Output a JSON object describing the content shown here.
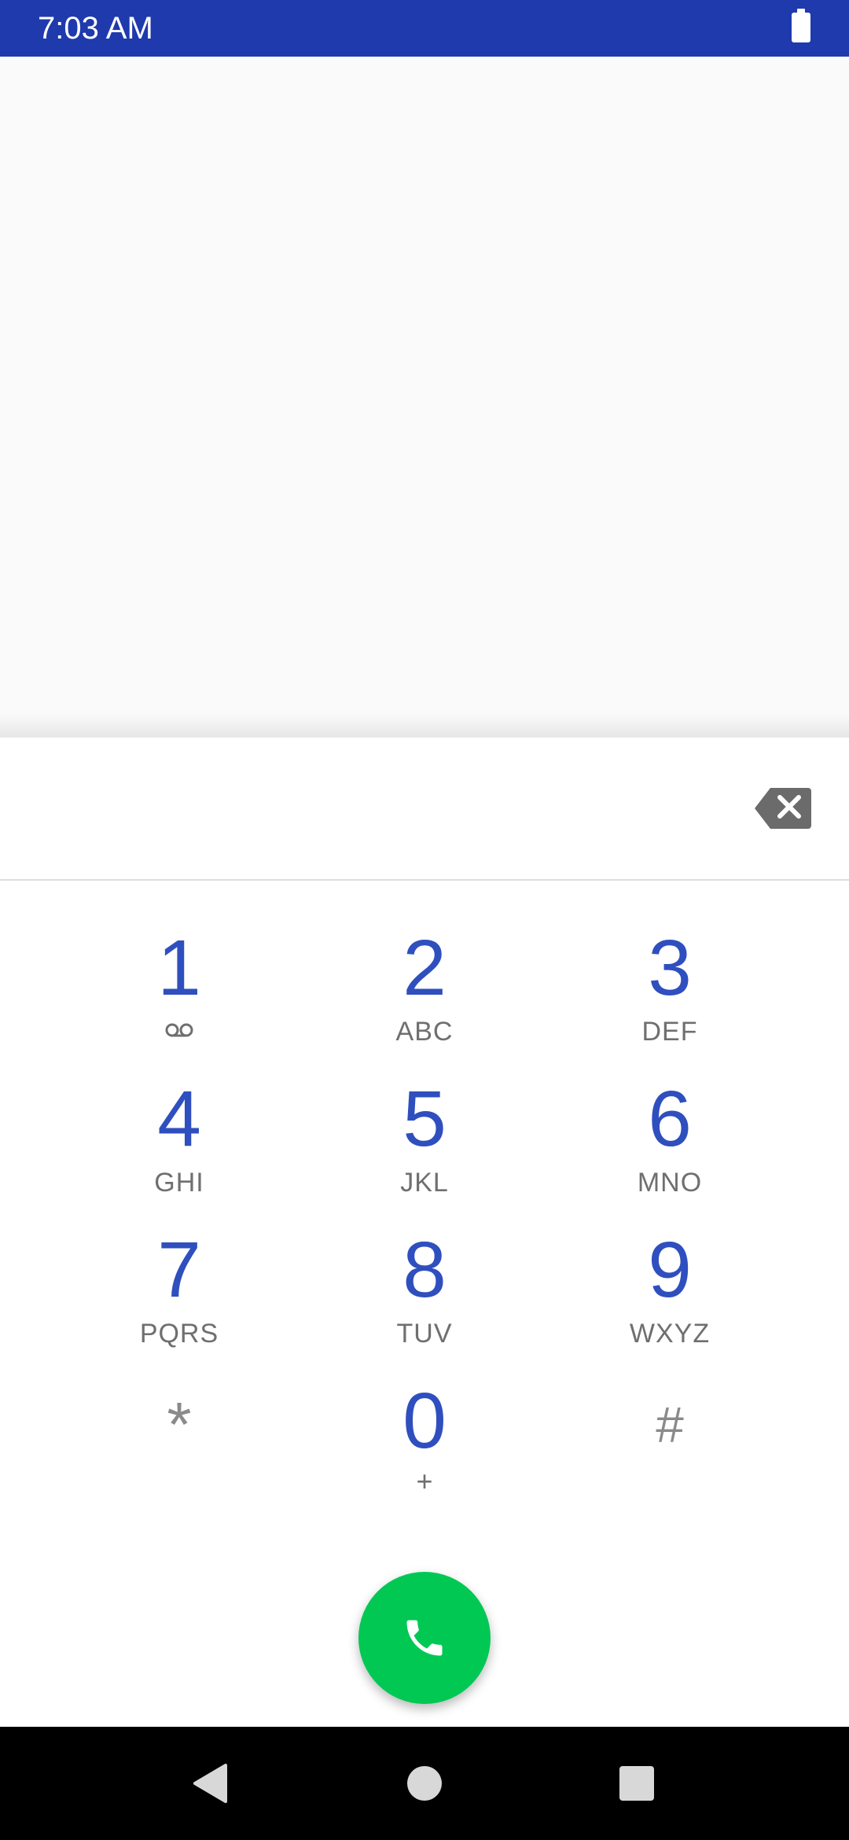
{
  "status_bar": {
    "time": "7:03 AM",
    "battery_icon": "battery-full-icon"
  },
  "dialer": {
    "digits_value": "",
    "backspace_icon": "backspace-icon"
  },
  "keys": [
    {
      "digit": "1",
      "letters": "",
      "icon": "voicemail-icon"
    },
    {
      "digit": "2",
      "letters": "ABC"
    },
    {
      "digit": "3",
      "letters": "DEF"
    },
    {
      "digit": "4",
      "letters": "GHI"
    },
    {
      "digit": "5",
      "letters": "JKL"
    },
    {
      "digit": "6",
      "letters": "MNO"
    },
    {
      "digit": "7",
      "letters": "PQRS"
    },
    {
      "digit": "8",
      "letters": "TUV"
    },
    {
      "digit": "9",
      "letters": "WXYZ"
    },
    {
      "digit": "*",
      "letters": ""
    },
    {
      "digit": "0",
      "letters": "+"
    },
    {
      "digit": "#",
      "letters": ""
    }
  ],
  "call_button": {
    "icon": "phone-icon"
  },
  "nav_bar": {
    "back_icon": "back-triangle-icon",
    "home_icon": "home-circle-icon",
    "recents_icon": "recents-square-icon"
  },
  "colors": {
    "status_bar": "#1e3aad",
    "digit": "#2f4fbf",
    "call_button": "#00c853"
  }
}
